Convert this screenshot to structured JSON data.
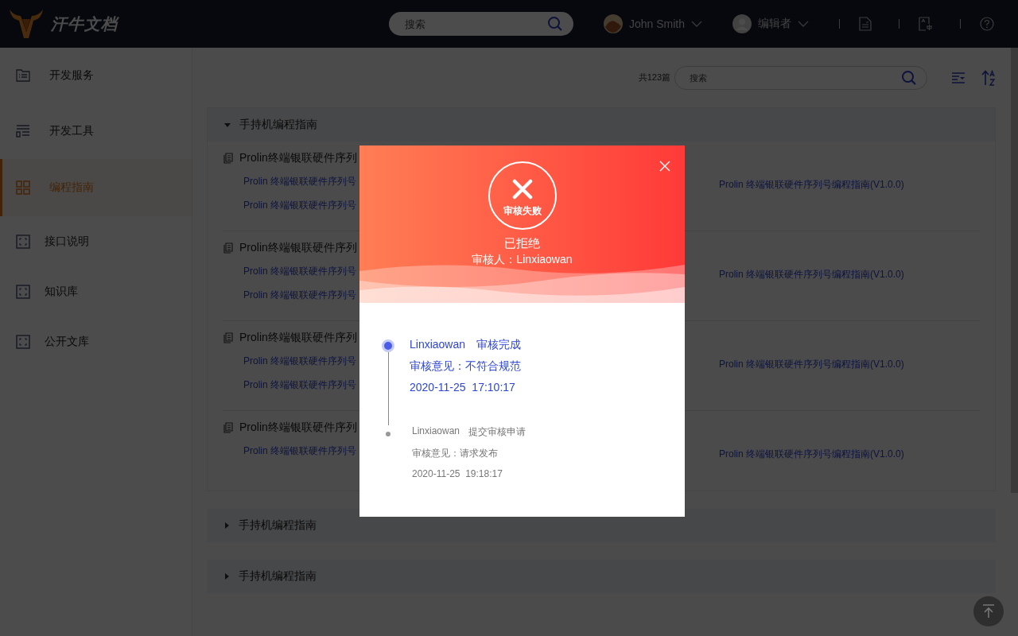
{
  "header": {
    "logo_text": "汗牛文档",
    "search": {
      "placeholder": "搜索"
    },
    "user": "John Smith",
    "role": "编辑者"
  },
  "sidebar": {
    "items": [
      {
        "label": "开发服务",
        "selected": false
      },
      {
        "label": "开发工具",
        "selected": false
      },
      {
        "label": "编程指南",
        "selected": true
      },
      {
        "label": "接口说明",
        "selected": false
      },
      {
        "label": "知识库",
        "selected": false
      },
      {
        "label": "公开文库",
        "selected": false
      }
    ]
  },
  "toolbar": {
    "count": "共123篇",
    "search": {
      "placeholder": "搜索"
    }
  },
  "sections": [
    {
      "title": "手持机编程指南",
      "expanded": true,
      "cards": [
        {
          "title": "Prolin终端银联硬件序列",
          "links": [
            "Prolin 终端银联硬件序列号",
            "Prolin 终端银联硬件序列号"
          ],
          "right_link": "Prolin 终端银联硬件序列号编程指南(V1.0.0)"
        },
        {
          "title": "Prolin终端银联硬件序列",
          "links": [
            "Prolin 终端银联硬件序列号",
            "Prolin 终端银联硬件序列号"
          ],
          "right_link": "Prolin 终端银联硬件序列号编程指南(V1.0.0)"
        },
        {
          "title": "Prolin终端银联硬件序列",
          "links": [
            "Prolin 终端银联硬件序列号",
            "Prolin 终端银联硬件序列号"
          ],
          "right_link": "Prolin 终端银联硬件序列号编程指南(V1.0.0)"
        },
        {
          "title": "Prolin终端银联硬件序列",
          "links": [
            "Prolin 终端银联硬件序列号"
          ],
          "right_link": "Prolin 终端银联硬件序列号编程指南(V1.0.0)"
        }
      ]
    },
    {
      "title": "手持机编程指南",
      "expanded": false
    },
    {
      "title": "手持机编程指南",
      "expanded": false
    }
  ],
  "modal": {
    "badge": "审核失败",
    "status": "已拒绝",
    "reviewer": "审核人：Linxiaowan",
    "timeline": [
      {
        "current": true,
        "name": "Linxiaowan",
        "action": "审核完成",
        "opinion": "审核意见：不符合规范",
        "time": "2020-11-25  17:10:17"
      },
      {
        "current": false,
        "name": "Linxiaowan",
        "action": "提交审核申请",
        "opinion": "审核意见：请求发布",
        "time": "2020-11-25  19:18:17"
      }
    ]
  }
}
